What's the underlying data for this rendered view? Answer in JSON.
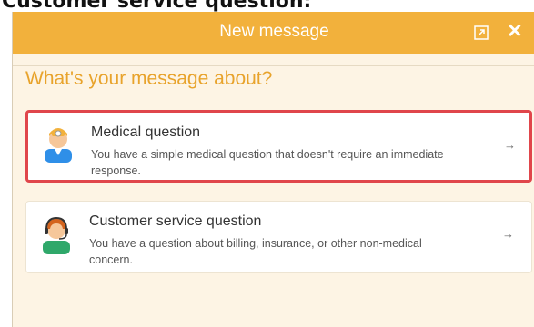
{
  "page_label": "Customer service question:",
  "window": {
    "title": "New message",
    "expand_icon": "expand-icon",
    "close_icon": "close-icon",
    "close_glyph": "✕"
  },
  "prompt": "What's your message about?",
  "options": [
    {
      "title": "Medical question",
      "description": "You have a simple medical question that doesn't require an immediate response.",
      "icon": "doctor-avatar-icon",
      "arrow": "→",
      "highlighted": true
    },
    {
      "title": "Customer service question",
      "description": "You have a question about billing, insurance, or other non-medical concern.",
      "icon": "headset-agent-avatar-icon",
      "arrow": "→",
      "highlighted": false
    }
  ],
  "colors": {
    "header": "#f2b13c",
    "prompt": "#e8a32b",
    "highlight_border": "#e0464b",
    "panel_bg": "#fdf4e4"
  }
}
